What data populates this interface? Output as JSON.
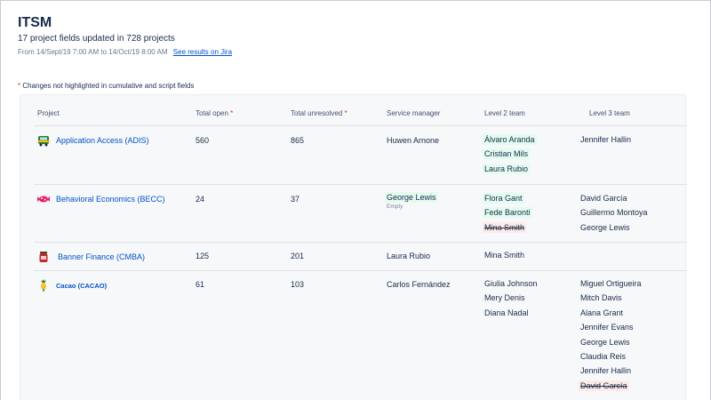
{
  "header": {
    "title": "ITSM",
    "subtitle": "17 project fields updated in 728 projects",
    "date_range": "From 14/Sept/19 7:00 AM to 14/Oct/19 8:00 AM",
    "results_link": "See results on Jira"
  },
  "note": {
    "star": "*",
    "text": " Changes not highlighted in cumulative and script fields"
  },
  "table": {
    "columns": {
      "project": "Project",
      "total_open": "Total open",
      "total_unresolved": "Total unresolved",
      "service_manager": "Service manager",
      "level2": "Level 2 team",
      "level3": "Level 3 team",
      "required_mark": "*"
    },
    "rows": [
      {
        "icon": "bus-icon",
        "name": "Application Access (ADIS)",
        "total_open": "560",
        "total_unresolved": "865",
        "service_manager": "Huwen Arnone",
        "level2": [
          "Álvaro Aranda",
          "Cristian Mils",
          "Laura Rubio"
        ],
        "level3": [
          "Jennifer Hallin"
        ]
      },
      {
        "icon": "candy-icon",
        "name": "Behavioral Economics (BECC)",
        "total_open": "24",
        "total_unresolved": "37",
        "service_manager": "George Lewis",
        "service_manager_sub": "Empty",
        "level2": [
          "Flora Gant",
          "Fede Baronti",
          "Mina Smith"
        ],
        "level3": [
          "David García",
          "Guillermo Montoya",
          "George Lewis"
        ]
      },
      {
        "icon": "jar-icon",
        "name": "Banner Finance  (CMBA)",
        "total_open": "125",
        "total_unresolved": "201",
        "service_manager": "Laura Rubio",
        "level2": [
          "Mina Smith"
        ],
        "level3": []
      },
      {
        "icon": "pineapple-icon",
        "name": "Cacao (CACAO)",
        "total_open": "61",
        "total_unresolved": "103",
        "service_manager": "Carlos Fernández",
        "level2": [
          "Giulia Johnson",
          "Mery Denis",
          "Diana Nadal"
        ],
        "level3": [
          "Miguel Ortigueira",
          "Mitch Davis",
          "Alana Grant",
          "Jennifer Evans",
          "George Lewis",
          "Claudia Reis",
          "Jennifer Hallin",
          "David García"
        ]
      }
    ]
  },
  "colors": {
    "link": "#0052cc",
    "added_highlight": "#e3fcef",
    "removed_highlight": "#ffebe6",
    "required_star": "#de350b"
  }
}
